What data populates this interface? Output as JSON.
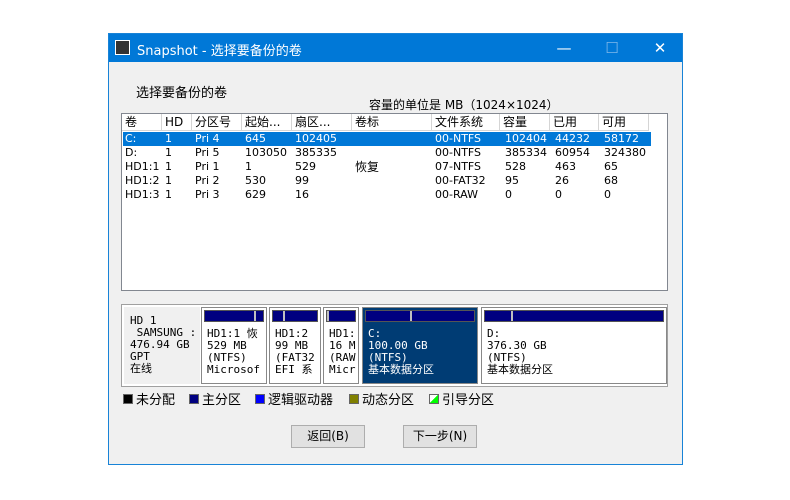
{
  "window": {
    "title": "Snapshot - 选择要备份的卷",
    "minimize": "—",
    "maximize": "☐",
    "close": "✕"
  },
  "heading": "选择要备份的卷",
  "unit_note": "容量的单位是 MB（1024×1024）",
  "columns": [
    "卷",
    "HD",
    "分区号",
    "起始...",
    "扇区...",
    "卷标",
    "文件系统",
    "容量",
    "已用",
    "可用"
  ],
  "rows": [
    [
      "C:",
      "1",
      "Pri  4",
      "645",
      "102405",
      "",
      "00-NTFS",
      "102404",
      "44232",
      "58172"
    ],
    [
      "D:",
      "1",
      "Pri  5",
      "103050",
      "385335",
      "",
      "00-NTFS",
      "385334",
      "60954",
      "324380"
    ],
    [
      "HD1:1",
      "1",
      "Pri  1",
      "1",
      "529",
      "恢复",
      "07-NTFS",
      "528",
      "463",
      "65"
    ],
    [
      "HD1:2",
      "1",
      "Pri  2",
      "530",
      "99",
      "",
      "00-FAT32",
      "95",
      "26",
      "68"
    ],
    [
      "HD1:3",
      "1",
      "Pri  3",
      "629",
      "16",
      "",
      "00-RAW",
      "0",
      "0",
      "0"
    ]
  ],
  "selected_row": 0,
  "disk": {
    "text": "HD 1\n SAMSUNG :\n476.94 GB\nGPT\n在线"
  },
  "partitions": [
    {
      "text": "HD1:1 恢\n529 MB\n(NTFS)\nMicrosof",
      "used_pct": 88
    },
    {
      "text": "HD1:2\n99 MB\n(FAT32\nEFI 系",
      "used_pct": 27
    },
    {
      "text": "HD1:\n16 M\n(RAW\nMicr",
      "used_pct": 0
    },
    {
      "text": "C:\n100.00 GB\n(NTFS)\n基本数据分区",
      "used_pct": 43
    },
    {
      "text": "D:\n376.30 GB\n(NTFS)\n基本数据分区",
      "used_pct": 16
    }
  ],
  "legend": [
    {
      "label": "未分配",
      "color": "#000000"
    },
    {
      "label": "主分区",
      "color": "#000080"
    },
    {
      "label": "逻辑驱动器",
      "color": "#0000ff"
    },
    {
      "label": "动态分区",
      "color": "#808000"
    },
    {
      "label": "引导分区",
      "color": "#00ff00"
    }
  ],
  "buttons": {
    "back": "返回(B)",
    "next": "下一步(N)"
  }
}
